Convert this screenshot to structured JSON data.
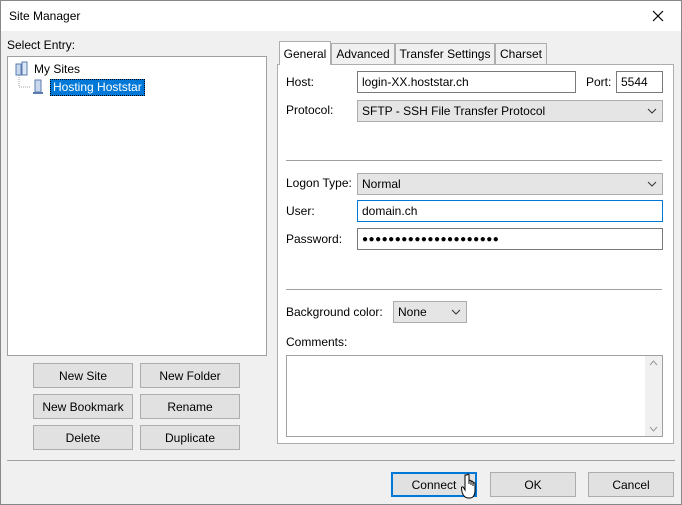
{
  "window": {
    "title": "Site Manager"
  },
  "left": {
    "select_entry_label": "Select Entry:",
    "tree": {
      "root": "My Sites",
      "selected": "Hosting Hoststar"
    },
    "buttons": {
      "new_site": "New Site",
      "new_folder": "New Folder",
      "new_bookmark": "New Bookmark",
      "rename": "Rename",
      "delete": "Delete",
      "duplicate": "Duplicate"
    }
  },
  "tabs": [
    "General",
    "Advanced",
    "Transfer Settings",
    "Charset"
  ],
  "general": {
    "host_label": "Host:",
    "host_value": "login-XX.hoststar.ch",
    "port_label": "Port:",
    "port_value": "5544",
    "protocol_label": "Protocol:",
    "protocol_value": "SFTP - SSH File Transfer Protocol",
    "logon_type_label": "Logon Type:",
    "logon_type_value": "Normal",
    "user_label": "User:",
    "user_value": "domain.ch",
    "password_label": "Password:",
    "password_value": "●●●●●●●●●●●●●●●●●●●●●",
    "background_label": "Background color:",
    "background_value": "None",
    "comments_label": "Comments:"
  },
  "footer": {
    "connect": "Connect",
    "ok": "OK",
    "cancel": "Cancel"
  },
  "colors": {
    "accent": "#0078d7",
    "window_bg": "#f0f0f0"
  }
}
